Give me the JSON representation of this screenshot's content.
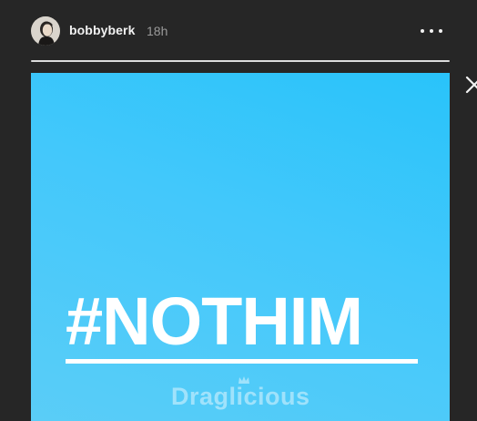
{
  "header": {
    "username": "bobbyberk",
    "timestamp": "18h",
    "more_icon": "more-horizontal-icon"
  },
  "progress": {
    "fraction": 1.0
  },
  "close_icon": "close-icon",
  "story": {
    "headline": "#NOTHIM",
    "watermark": "Draglicious",
    "background_colors": [
      "#29c3fa",
      "#5acdf7"
    ]
  },
  "colors": {
    "page_background": "#262626",
    "text_primary": "#f2f2f2",
    "text_secondary": "#9a9a9a"
  }
}
